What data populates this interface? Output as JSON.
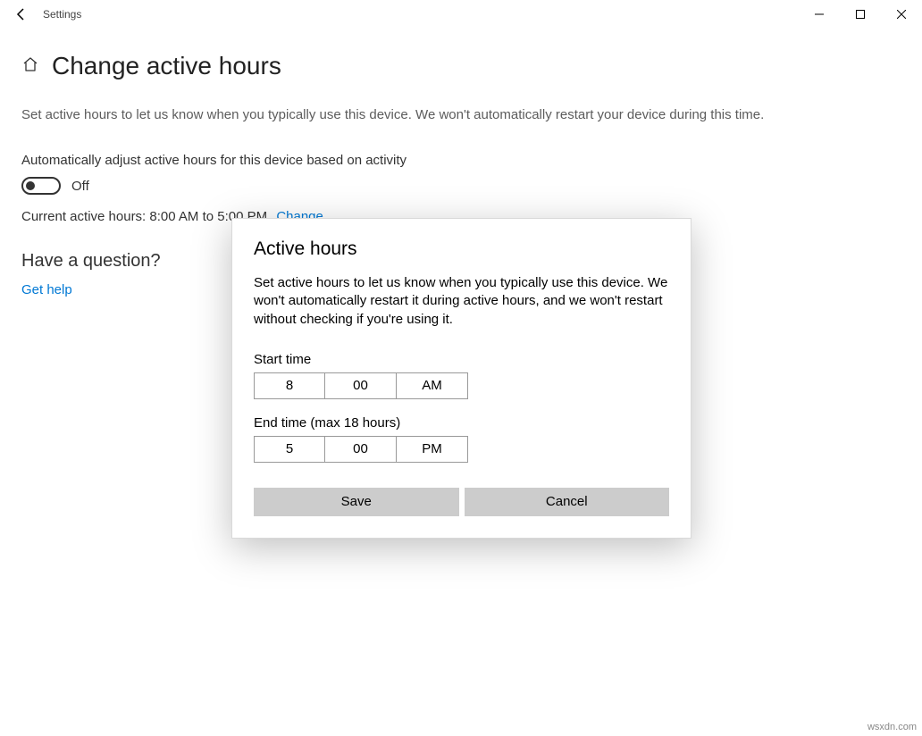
{
  "titlebar": {
    "app_name": "Settings"
  },
  "page": {
    "title": "Change active hours",
    "description": "Set active hours to let us know when you typically use this device. We won't automatically restart your device during this time.",
    "auto_adjust_label": "Automatically adjust active hours for this device based on activity",
    "toggle_state": "Off",
    "current_hours_text": "Current active hours: 8:00 AM to 5:00 PM",
    "change_link": "Change",
    "question_title": "Have a question?",
    "help_link": "Get help"
  },
  "dialog": {
    "title": "Active hours",
    "description": "Set active hours to let us know when you typically use this device. We won't automatically restart it during active hours, and we won't restart without checking if you're using it.",
    "start_label": "Start time",
    "start": {
      "hour": "8",
      "minute": "00",
      "ampm": "AM"
    },
    "end_label": "End time (max 18 hours)",
    "end": {
      "hour": "5",
      "minute": "00",
      "ampm": "PM"
    },
    "save": "Save",
    "cancel": "Cancel"
  },
  "watermark": "wsxdn.com"
}
